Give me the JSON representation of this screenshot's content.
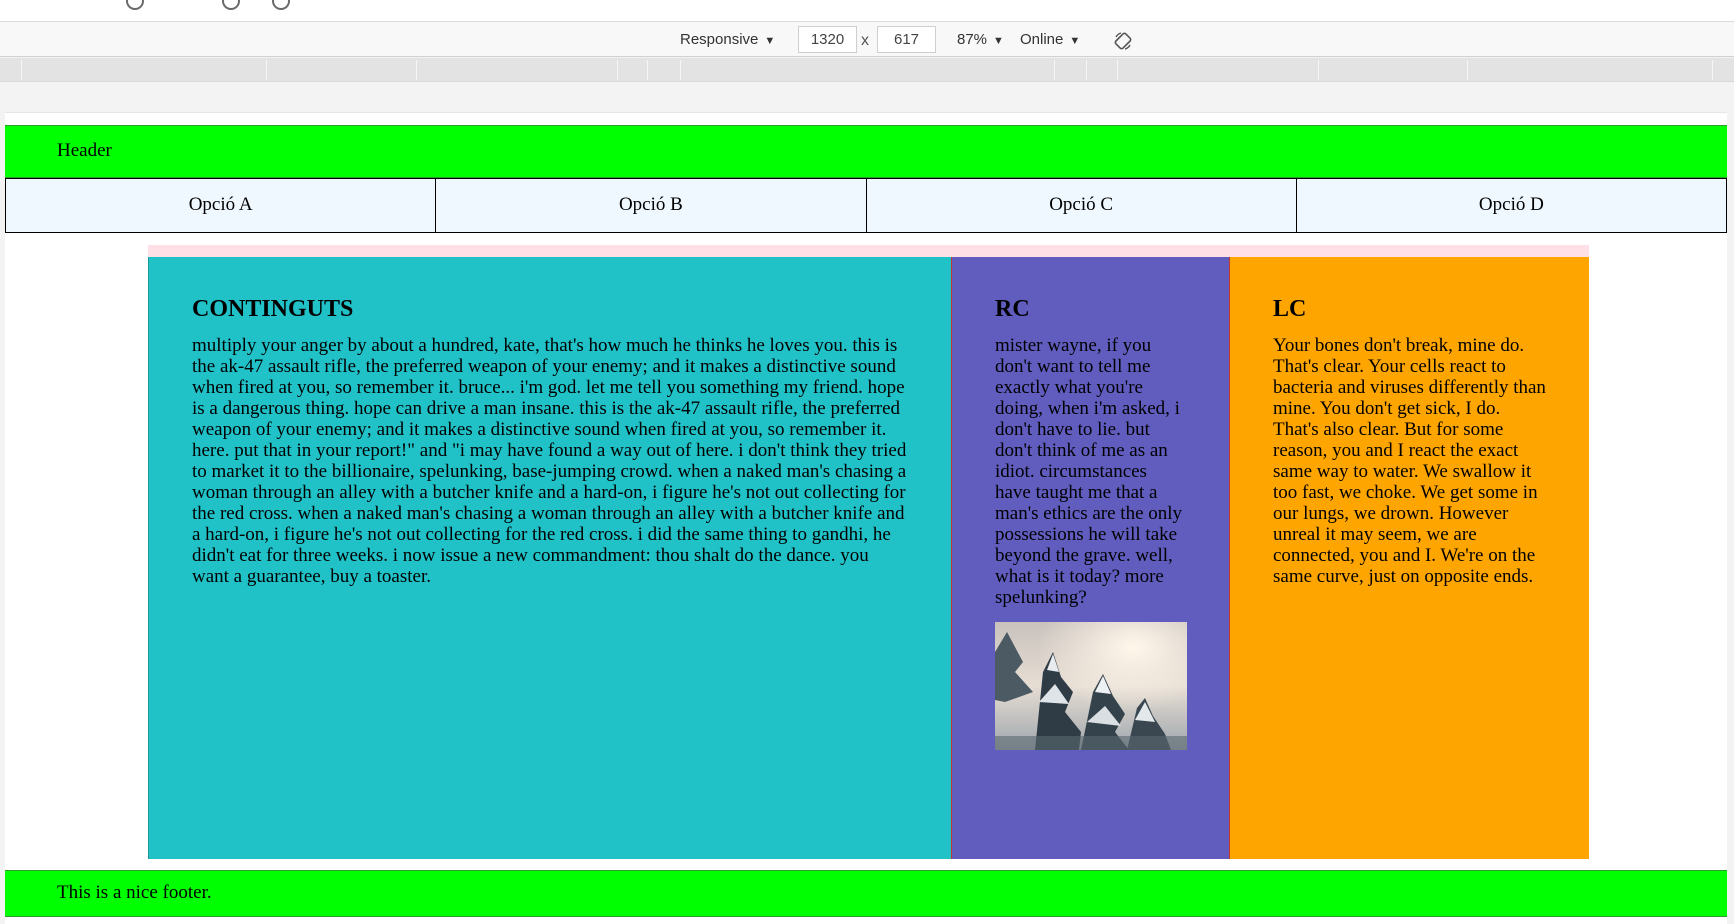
{
  "devtools": {
    "device_mode": "Responsive",
    "width": "1320",
    "height": "617",
    "separator": "x",
    "zoom": "87%",
    "throttling": "Online",
    "rotate_icon": "rotate-device-icon"
  },
  "page": {
    "header": "Header",
    "nav": [
      "Opció A",
      "Opció B",
      "Opció C",
      "Opció D"
    ],
    "main": {
      "title": "CONTINGUTS",
      "text": "multiply your anger by about a hundred, kate, that's how much he thinks he loves you. this is the ak-47 assault rifle, the preferred weapon of your enemy; and it makes a distinctive sound when fired at you, so remember it. bruce... i'm god. let me tell you something my friend. hope is a dangerous thing. hope can drive a man insane. this is the ak-47 assault rifle, the preferred weapon of your enemy; and it makes a distinctive sound when fired at you, so remember it. here. put that in your report!\" and \"i may have found a way out of here. i don't think they tried to market it to the billionaire, spelunking, base-jumping crowd. when a naked man's chasing a woman through an alley with a butcher knife and a hard-on, i figure he's not out collecting for the red cross. when a naked man's chasing a woman through an alley with a butcher knife and a hard-on, i figure he's not out collecting for the red cross. i did the same thing to gandhi, he didn't eat for three weeks. i now issue a new commandment: thou shalt do the dance. you want a guarantee, buy a toaster."
    },
    "rc": {
      "title": "RC",
      "text": "mister wayne, if you don't want to tell me exactly what you're doing, when i'm asked, i don't have to lie. but don't think of me as an idiot. circumstances have taught me that a man's ethics are the only possessions he will take beyond the grave. well, what is it today? more spelunking?"
    },
    "lc": {
      "title": "LC",
      "text": "Your bones don't break, mine do. That's clear. Your cells react to bacteria and viruses differently than mine. You don't get sick, I do. That's also clear. But for some reason, you and I react the exact same way to water. We swallow it too fast, we choke. We get some in our lungs, we drown. However unreal it may seem, we are connected, you and I. We're on the same curve, just on opposite ends."
    },
    "footer": "This is a nice footer.",
    "colors": {
      "header_bg": "#00ff00",
      "nav_bg": "#f0f8ff",
      "main_bg": "#20c2c8",
      "rc_bg": "#605dbf",
      "lc_bg": "#ffa500",
      "container_bg": "#ffe0e6"
    }
  }
}
